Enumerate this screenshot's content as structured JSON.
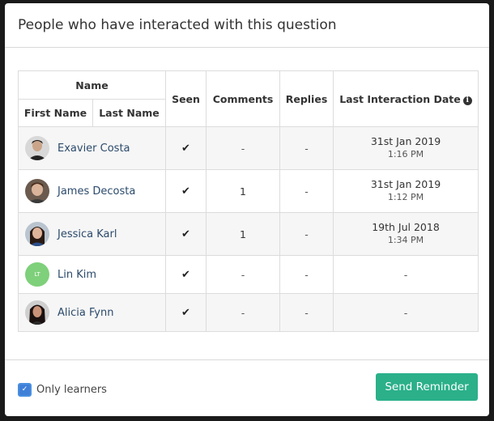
{
  "modal": {
    "title": "People who have interacted with this question"
  },
  "table": {
    "headers": {
      "name": "Name",
      "first_name": "First Name",
      "last_name": "Last Name",
      "seen": "Seen",
      "comments": "Comments",
      "replies": "Replies",
      "last_interaction_date": "Last Interaction Date"
    },
    "rows": [
      {
        "name": "Exavier Costa",
        "seen": "✔",
        "comments": "-",
        "replies": "-",
        "date": "31st Jan 2019",
        "time": "1:16 PM",
        "avatar": "photo"
      },
      {
        "name": "James Decosta",
        "seen": "✔",
        "comments": "1",
        "replies": "-",
        "date": "31st Jan 2019",
        "time": "1:12 PM",
        "avatar": "photo"
      },
      {
        "name": "Jessica Karl",
        "seen": "✔",
        "comments": "1",
        "replies": "-",
        "date": "19th Jul 2018",
        "time": "1:34 PM",
        "avatar": "photo"
      },
      {
        "name": "Lin Kim",
        "seen": "✔",
        "comments": "-",
        "replies": "-",
        "date": "-",
        "time": "",
        "avatar": "initials",
        "initials": "LT"
      },
      {
        "name": "Alicia Fynn",
        "seen": "✔",
        "comments": "-",
        "replies": "-",
        "date": "-",
        "time": "",
        "avatar": "photo"
      }
    ]
  },
  "footer": {
    "only_learners_label": "Only learners",
    "only_learners_checked": true,
    "send_reminder_label": "Send Reminder"
  },
  "icons": {
    "info": "info-circle-icon",
    "check": "checkmark-icon"
  },
  "colors": {
    "accent_button": "#2bb08a",
    "checkbox": "#3f7fd8",
    "name_link": "#2b4a6b",
    "initials_avatar": "#7ed07a"
  }
}
